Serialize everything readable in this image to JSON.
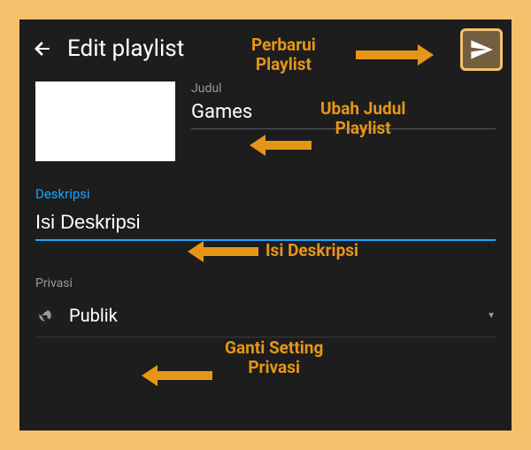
{
  "header": {
    "title": "Edit playlist"
  },
  "fields": {
    "title_label": "Judul",
    "title_value": "Games",
    "description_label": "Deskripsi",
    "description_placeholder": "Isi Deskripsi",
    "description_value": "",
    "privacy_label": "Privasi",
    "privacy_value": "Publik"
  },
  "annotations": {
    "update": "Perbarui\nPlaylist",
    "change_title": "Ubah Judul\nPlaylist",
    "fill_desc": "Isi Deskripsi",
    "change_privacy": "Ganti Setting\nPrivasi"
  },
  "colors": {
    "frame": "#f5c16c",
    "screen_bg": "#1d1d1d",
    "accent_blue": "#1da4ff",
    "annotation": "#e69617"
  }
}
